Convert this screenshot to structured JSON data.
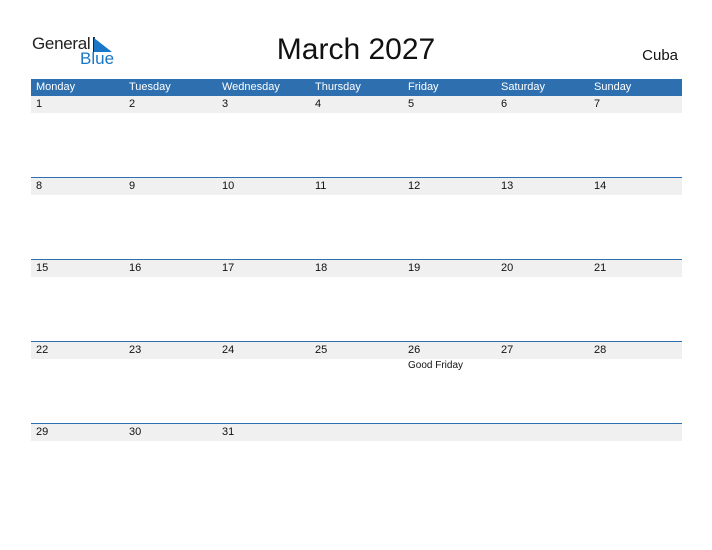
{
  "logo": {
    "general": "General",
    "blue": "Blue"
  },
  "title": "March 2027",
  "country": "Cuba",
  "weekdays": [
    "Monday",
    "Tuesday",
    "Wednesday",
    "Thursday",
    "Friday",
    "Saturday",
    "Sunday"
  ],
  "weeks": [
    {
      "days": [
        "1",
        "2",
        "3",
        "4",
        "5",
        "6",
        "7"
      ],
      "events": [
        "",
        "",
        "",
        "",
        "",
        "",
        ""
      ]
    },
    {
      "days": [
        "8",
        "9",
        "10",
        "11",
        "12",
        "13",
        "14"
      ],
      "events": [
        "",
        "",
        "",
        "",
        "",
        "",
        ""
      ]
    },
    {
      "days": [
        "15",
        "16",
        "17",
        "18",
        "19",
        "20",
        "21"
      ],
      "events": [
        "",
        "",
        "",
        "",
        "",
        "",
        ""
      ]
    },
    {
      "days": [
        "22",
        "23",
        "24",
        "25",
        "26",
        "27",
        "28"
      ],
      "events": [
        "",
        "",
        "",
        "",
        "Good Friday",
        "",
        ""
      ]
    },
    {
      "days": [
        "29",
        "30",
        "31",
        "",
        "",
        "",
        ""
      ],
      "events": [
        "",
        "",
        "",
        "",
        "",
        "",
        ""
      ]
    }
  ],
  "colors": {
    "header": "#2e6fb0",
    "daystrip": "#f0f0f0",
    "brand": "#1a76c6"
  }
}
